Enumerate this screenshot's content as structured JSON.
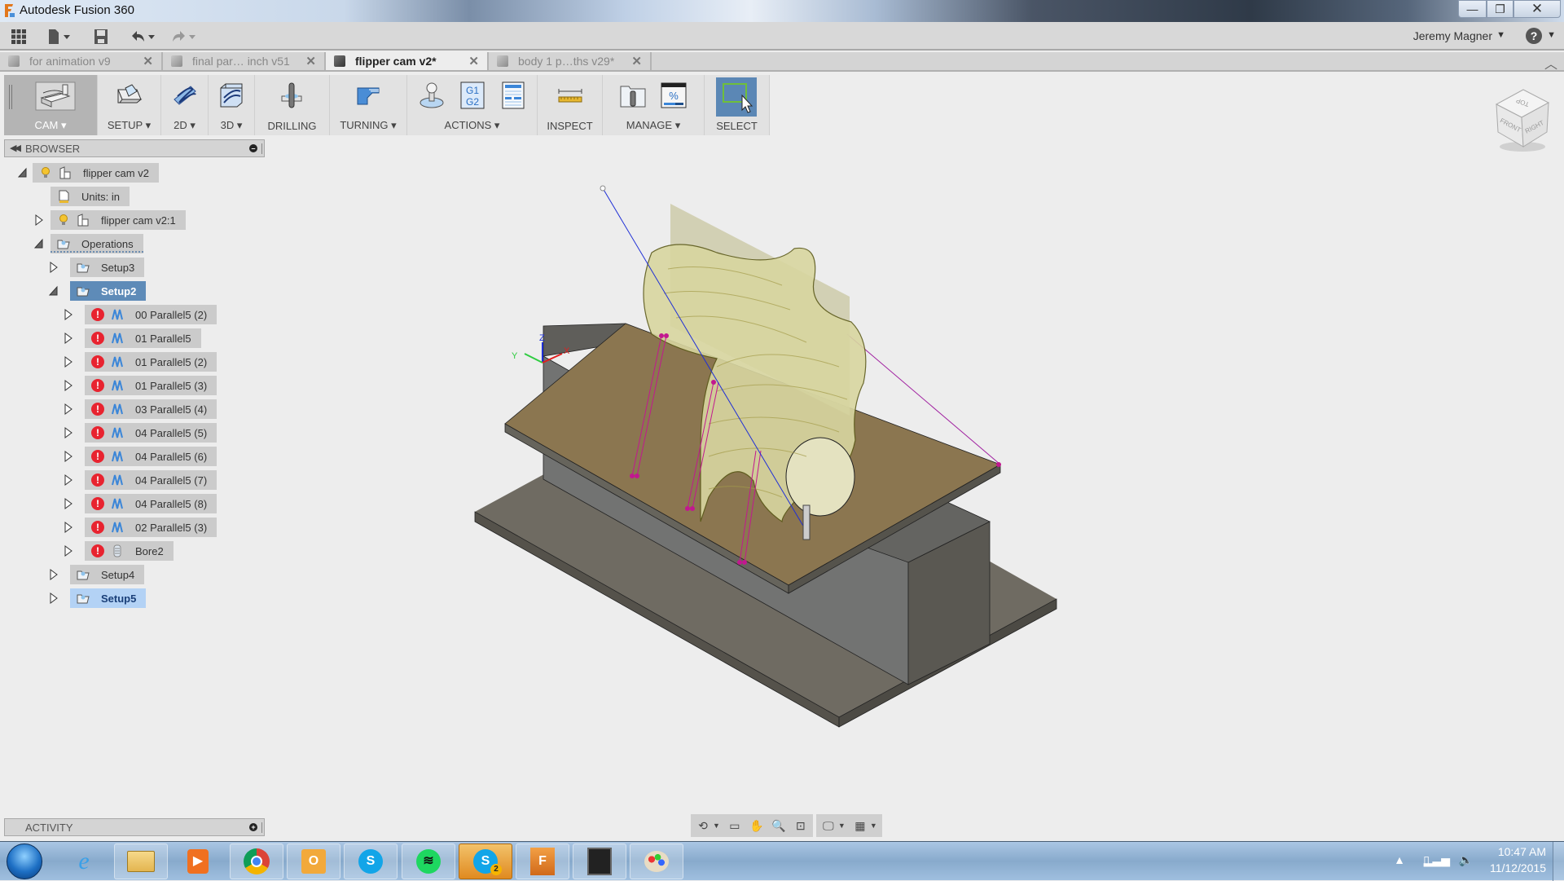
{
  "window": {
    "title": "Autodesk Fusion 360",
    "minimize_label": "—",
    "restore_label": "❐",
    "close_label": "✕"
  },
  "quick_access": {
    "user_name": "Jeremy Magner",
    "help_label": "?",
    "caret": "▼"
  },
  "document_tabs": [
    {
      "label": "for animation v9",
      "active": false
    },
    {
      "label": "final par… inch v51",
      "active": false
    },
    {
      "label": "flipper cam v2*",
      "active": true
    },
    {
      "label": "body 1 p…ths v29*",
      "active": false
    }
  ],
  "tab_close_glyph": "✕",
  "ribbon": {
    "workspace": "CAM ▾",
    "groups": [
      {
        "label": "SETUP ▾"
      },
      {
        "label": "2D ▾"
      },
      {
        "label": "3D ▾"
      },
      {
        "label": "DRILLING"
      },
      {
        "label": "TURNING ▾"
      },
      {
        "label": "ACTIONS ▾"
      },
      {
        "label": "INSPECT"
      },
      {
        "label": "MANAGE ▾"
      },
      {
        "label": "SELECT"
      }
    ],
    "actions_g1g2": "G1\nG2",
    "manage_percent": "%"
  },
  "viewcube": {
    "top": "TOP",
    "front": "FRONT",
    "right": "RIGHT"
  },
  "browser": {
    "title": "BROWSER",
    "tree": [
      {
        "label": "flipper cam v2",
        "level": 0,
        "toggle": "expanded",
        "icons": [
          "lightbulb",
          "component"
        ]
      },
      {
        "label": "Units: in",
        "level": 1,
        "toggle": "none",
        "icons": [
          "units-document"
        ]
      },
      {
        "label": "flipper cam v2:1",
        "level": 1,
        "toggle": "collapsed",
        "icons": [
          "lightbulb",
          "component"
        ]
      },
      {
        "label": "Operations",
        "level": 1,
        "toggle": "expanded",
        "icons": [
          "setup-folder"
        ]
      },
      {
        "label": "Setup3",
        "level": 2,
        "toggle": "collapsed",
        "icons": [
          "setup-folder"
        ]
      },
      {
        "label": "Setup2",
        "level": 2,
        "toggle": "expanded",
        "icons": [
          "setup-folder"
        ],
        "state": "selected"
      },
      {
        "label": "00 Parallel5 (2)",
        "level": 3,
        "toggle": "collapsed",
        "icons": [
          "error",
          "parallel-toolpath"
        ]
      },
      {
        "label": "01 Parallel5",
        "level": 3,
        "toggle": "collapsed",
        "icons": [
          "error",
          "parallel-toolpath"
        ]
      },
      {
        "label": "01 Parallel5 (2)",
        "level": 3,
        "toggle": "collapsed",
        "icons": [
          "error",
          "parallel-toolpath"
        ]
      },
      {
        "label": "01 Parallel5 (3)",
        "level": 3,
        "toggle": "collapsed",
        "icons": [
          "error",
          "parallel-toolpath"
        ]
      },
      {
        "label": "03 Parallel5 (4)",
        "level": 3,
        "toggle": "collapsed",
        "icons": [
          "error",
          "parallel-toolpath"
        ]
      },
      {
        "label": "04 Parallel5 (5)",
        "level": 3,
        "toggle": "collapsed",
        "icons": [
          "error",
          "parallel-toolpath"
        ]
      },
      {
        "label": "04 Parallel5 (6)",
        "level": 3,
        "toggle": "collapsed",
        "icons": [
          "error",
          "parallel-toolpath"
        ]
      },
      {
        "label": "04 Parallel5 (7)",
        "level": 3,
        "toggle": "collapsed",
        "icons": [
          "error",
          "parallel-toolpath"
        ]
      },
      {
        "label": "04 Parallel5 (8)",
        "level": 3,
        "toggle": "collapsed",
        "icons": [
          "error",
          "parallel-toolpath"
        ]
      },
      {
        "label": "02 Parallel5 (3)",
        "level": 3,
        "toggle": "collapsed",
        "icons": [
          "error",
          "parallel-toolpath"
        ]
      },
      {
        "label": "Bore2",
        "level": 3,
        "toggle": "collapsed",
        "icons": [
          "error",
          "bore-toolpath"
        ]
      },
      {
        "label": "Setup4",
        "level": 2,
        "toggle": "collapsed",
        "icons": [
          "setup-folder"
        ]
      },
      {
        "label": "Setup5",
        "level": 2,
        "toggle": "collapsed",
        "icons": [
          "setup-folder"
        ],
        "state": "highlighted"
      }
    ]
  },
  "activity": {
    "title": "ACTIVITY"
  },
  "axes": {
    "x": "X",
    "y": "Y",
    "z": "Z"
  },
  "taskbar": {
    "apps": [
      {
        "name": "internet-explorer",
        "pinned": false
      },
      {
        "name": "file-explorer",
        "pinned": true
      },
      {
        "name": "media-player",
        "pinned": false
      },
      {
        "name": "chrome",
        "pinned": true
      },
      {
        "name": "outlook",
        "pinned": true
      },
      {
        "name": "skype",
        "pinned": true
      },
      {
        "name": "spotify",
        "pinned": true
      },
      {
        "name": "skype-notifications",
        "pinned": true,
        "badge": "2",
        "active": true
      },
      {
        "name": "fusion-360",
        "pinned": true
      },
      {
        "name": "inkscape",
        "pinned": true
      },
      {
        "name": "paint",
        "pinned": true
      }
    ],
    "time": "10:47 AM",
    "date": "11/12/2015"
  },
  "colors": {
    "selection_blue": "#5e8bb8",
    "highlight_blue": "#b3d2f5",
    "error_red": "#e8232f",
    "stock_brown": "#8b7650",
    "toolpath_magenta": "#c2188f",
    "model_yellow": "#d8d6a0"
  }
}
